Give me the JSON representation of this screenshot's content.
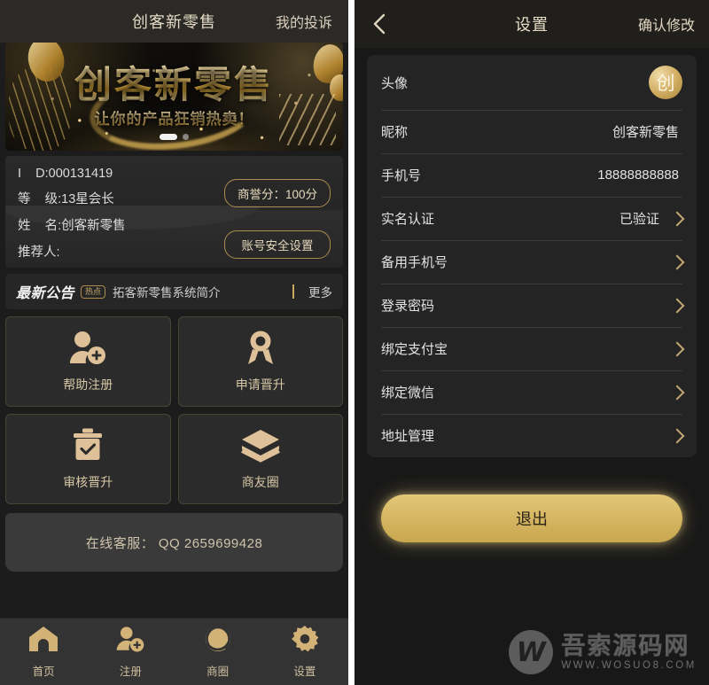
{
  "home": {
    "topbar": {
      "title": "创客新零售",
      "right_label": "我的投诉"
    },
    "banner": {
      "title": "创客新零售",
      "subtitle": "让你的产品狂销热卖！"
    },
    "profile": {
      "id_label": "I    D:",
      "id_value": "000131419",
      "level_label": "等    级:",
      "level_value": "13星会长",
      "name_label": "姓    名:",
      "name_value": "创客新零售",
      "referrer_label": "推荐人:",
      "referrer_value": "",
      "credit_button": "商誉分：100分",
      "security_button": "账号安全设置"
    },
    "announcement": {
      "title": "最新公告",
      "badge": "热点",
      "text": "拓客新零售系统简介",
      "more": "更多"
    },
    "cards": [
      {
        "label": "帮助注册",
        "icon": "user-add-icon"
      },
      {
        "label": "申请晋升",
        "icon": "medal-icon"
      },
      {
        "label": "审核晋升",
        "icon": "clipboard-check-icon"
      },
      {
        "label": "商友圈",
        "icon": "layers-icon"
      }
    ],
    "service": {
      "text": "在线客服： QQ 2659699428"
    },
    "nav": [
      {
        "label": "首页",
        "icon": "home-icon"
      },
      {
        "label": "注册",
        "icon": "user-add-icon"
      },
      {
        "label": "商圈",
        "icon": "aperture-icon"
      },
      {
        "label": "设置",
        "icon": "gear-icon"
      }
    ]
  },
  "settings": {
    "topbar": {
      "back_icon": "chevron-left-icon",
      "title": "设置",
      "confirm_label": "确认修改"
    },
    "rows": [
      {
        "label": "头像",
        "value": "",
        "avatar": "创",
        "chevron": false
      },
      {
        "label": "昵称",
        "value": "创客新零售",
        "chevron": false
      },
      {
        "label": "手机号",
        "value": "18888888888",
        "chevron": false
      },
      {
        "label": "实名认证",
        "value": "已验证",
        "chevron": true
      },
      {
        "label": "备用手机号",
        "value": "",
        "chevron": true
      },
      {
        "label": "登录密码",
        "value": "",
        "chevron": true
      },
      {
        "label": "绑定支付宝",
        "value": "",
        "chevron": true
      },
      {
        "label": "绑定微信",
        "value": "",
        "chevron": true
      },
      {
        "label": "地址管理",
        "value": "",
        "chevron": true
      }
    ],
    "logout_label": "退出"
  },
  "watermark": {
    "logo": "W",
    "cn": "吾索源码网",
    "en": "WWW.WOSUO8.COM"
  },
  "colors": {
    "gold": "#d4b26a",
    "gold_text": "#e4d9c4",
    "panel_bg": "#1c1c1c",
    "card_bg": "#2b2b2b",
    "settings_bg": "#242424",
    "logout": "#d6b764"
  }
}
